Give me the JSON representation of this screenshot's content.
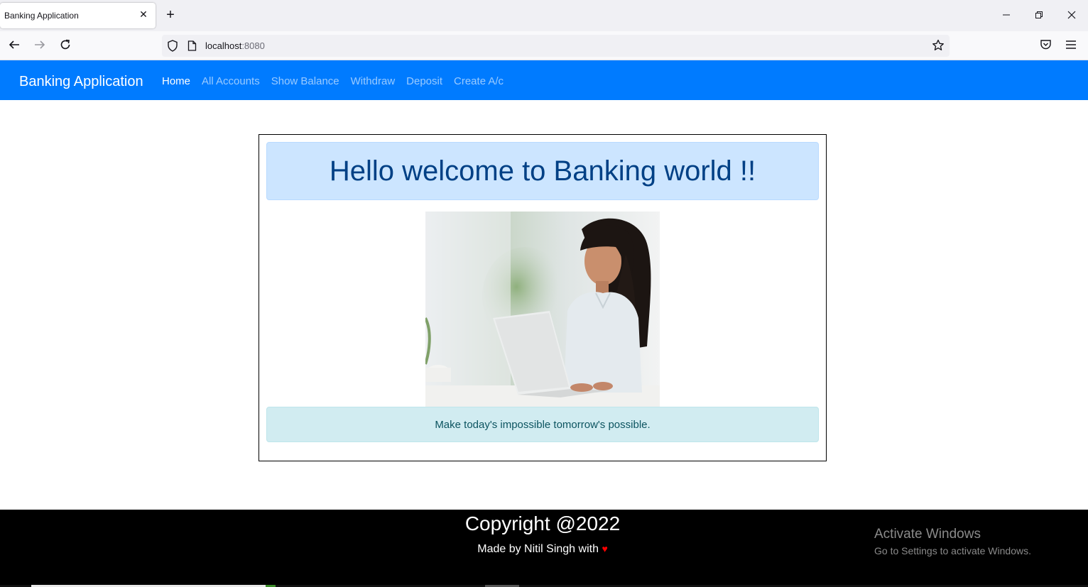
{
  "browser": {
    "tab_title": "Banking Application",
    "tab_close": "✕",
    "new_tab": "+",
    "url_host": "localhost",
    "url_port": ":8080"
  },
  "navbar": {
    "brand": "Banking Application",
    "links": [
      "Home",
      "All Accounts",
      "Show Balance",
      "Withdraw",
      "Deposit",
      "Create A/c"
    ],
    "active": "Home"
  },
  "main": {
    "welcome": "Hello welcome to Banking world !!",
    "quote": "Make today's impossible tomorrow's possible."
  },
  "footer": {
    "copyright": "Copyright @2022",
    "made_by": "Made by Nitil Singh with",
    "heart": "♥"
  },
  "watermark": {
    "title": "Activate Windows",
    "subtitle": "Go to Settings to activate Windows."
  },
  "colors": {
    "navbar_bg": "#007bff",
    "alert_primary_bg": "#cce5ff",
    "alert_info_bg": "#d1ecf1",
    "footer_bg": "#000000"
  }
}
